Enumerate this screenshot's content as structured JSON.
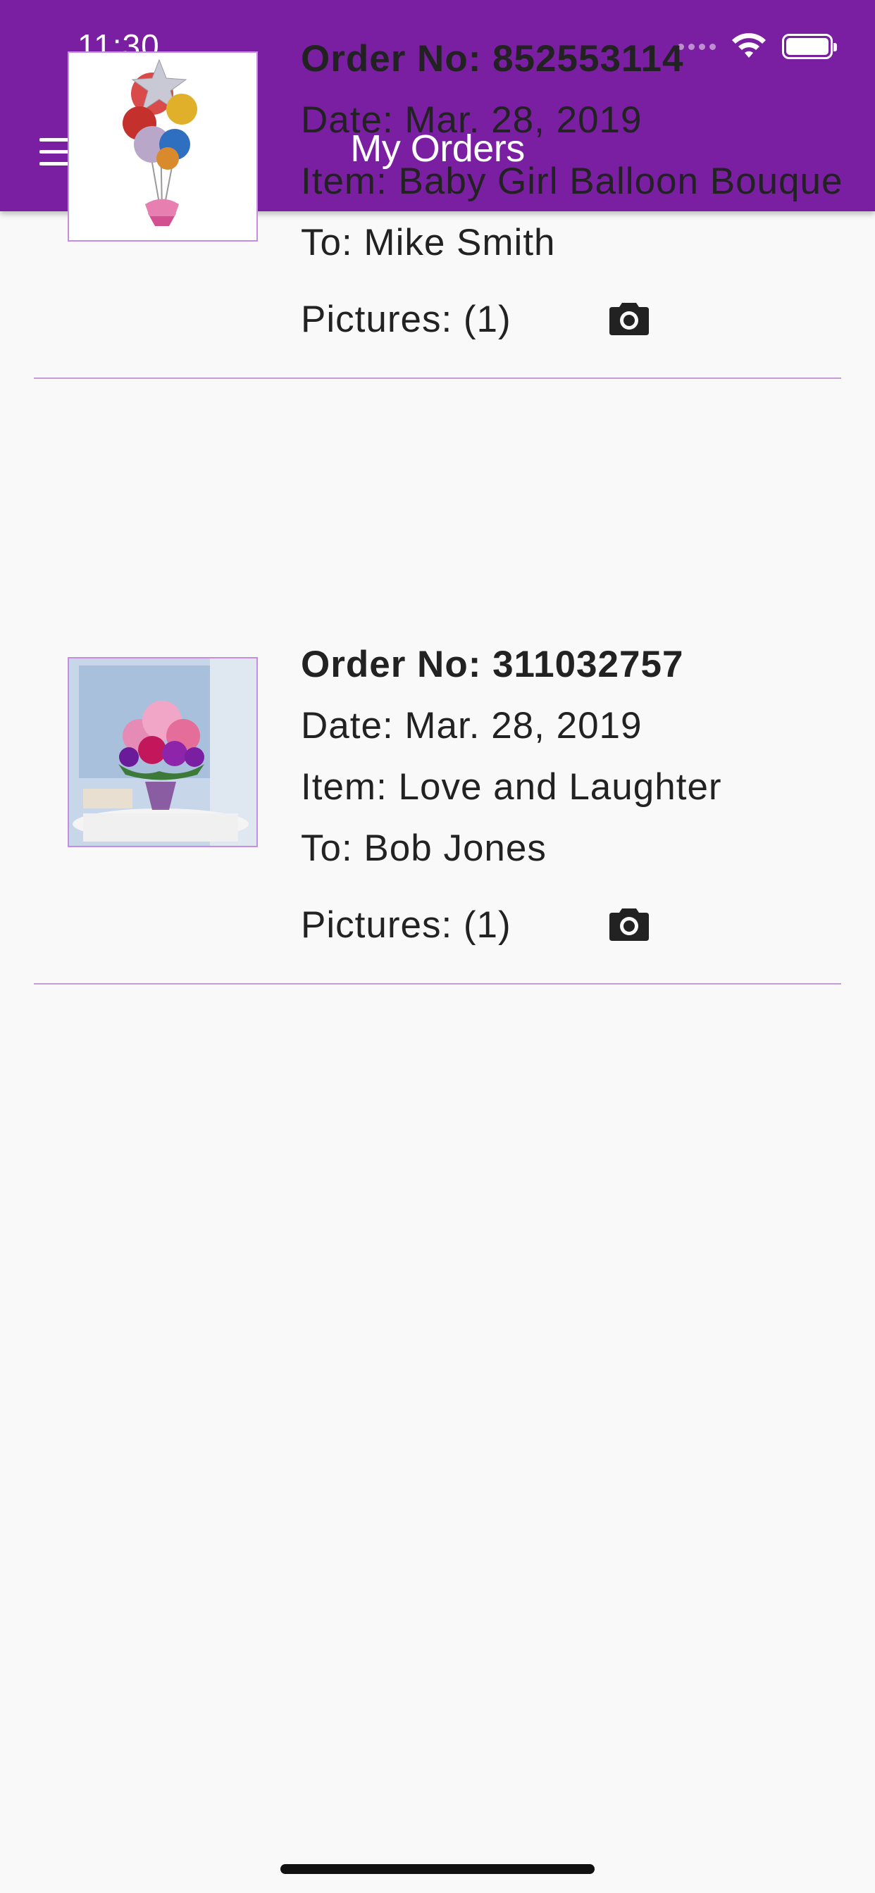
{
  "status_bar": {
    "time": "11:30"
  },
  "header": {
    "title": "My Orders",
    "menu_icon": "hamburger-menu-icon",
    "color": "#7a1fa2"
  },
  "orders": [
    {
      "order_label": "Order No: 311032757",
      "date_label": "Date: Mar. 28, 2019",
      "item_label": "Item: Love and Laughter",
      "to_label": "To: Bob Jones",
      "pictures_label": "Pictures: (1)",
      "thumbnail": "flower-vase-image",
      "action_icon": "camera-icon"
    },
    {
      "order_label": "Order No: 852553114",
      "date_label": "Date: Mar. 28, 2019",
      "item_label": "Item: Baby Girl Balloon Bouquet",
      "to_label": "To: Mike Smith",
      "pictures_label": "Pictures: (1)",
      "thumbnail": "balloon-bouquet-image",
      "action_icon": "camera-icon"
    }
  ],
  "colors": {
    "accent": "#7a1fa2",
    "divider": "#c79ad8",
    "background": "#f9f9f9",
    "text": "#222222"
  }
}
